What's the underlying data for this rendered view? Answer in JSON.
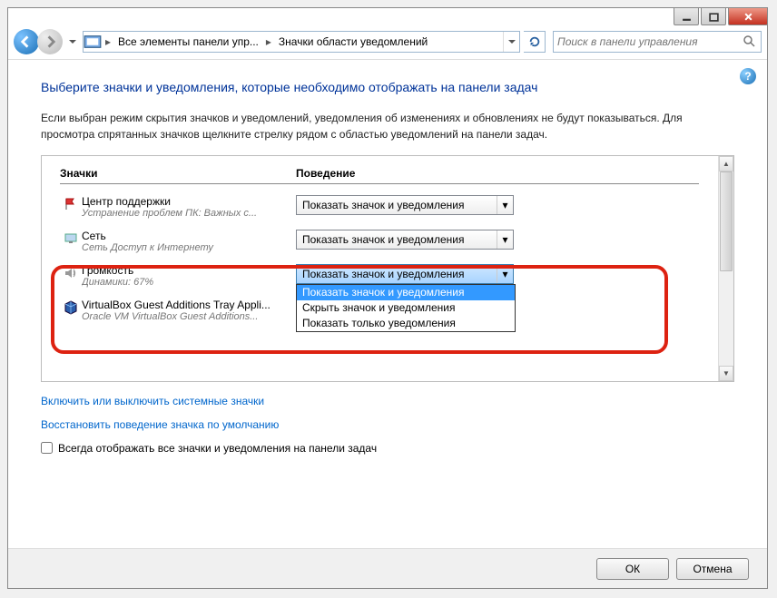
{
  "breadcrumb": {
    "root": "Все элементы панели упр...",
    "current": "Значки области уведомлений"
  },
  "search": {
    "placeholder": "Поиск в панели управления"
  },
  "heading": "Выберите значки и уведомления, которые необходимо отображать на панели задач",
  "description": "Если выбран режим скрытия значков и уведомлений, уведомления об изменениях и обновлениях не будут показываться. Для просмотра спрятанных значков щелкните стрелку рядом с областью уведомлений на панели задач.",
  "columns": {
    "icons": "Значки",
    "behavior": "Поведение"
  },
  "rows": [
    {
      "title": "Центр поддержки",
      "subtitle": "Устранение проблем ПК: Важных с...",
      "value": "Показать значок и уведомления",
      "icon": "flag"
    },
    {
      "title": "Сеть",
      "subtitle": "Сеть Доступ к Интернету",
      "value": "Показать значок и уведомления",
      "icon": "net"
    },
    {
      "title": "Громкость",
      "subtitle": "Динамики: 67%",
      "value": "Показать значок и уведомления",
      "icon": "vol",
      "open": true
    },
    {
      "title": "VirtualBox Guest Additions Tray Appli...",
      "subtitle": "Oracle VM VirtualBox Guest Additions...",
      "value": "",
      "icon": "vbox"
    }
  ],
  "dropdown_options": [
    "Показать значок и уведомления",
    "Скрыть значок и уведомления",
    "Показать только уведомления"
  ],
  "links": {
    "toggle": "Включить или выключить системные значки",
    "restore": "Восстановить поведение значка по умолчанию"
  },
  "checkbox_label": "Всегда отображать все значки и уведомления на панели задач",
  "buttons": {
    "ok": "ОК",
    "cancel": "Отмена"
  }
}
